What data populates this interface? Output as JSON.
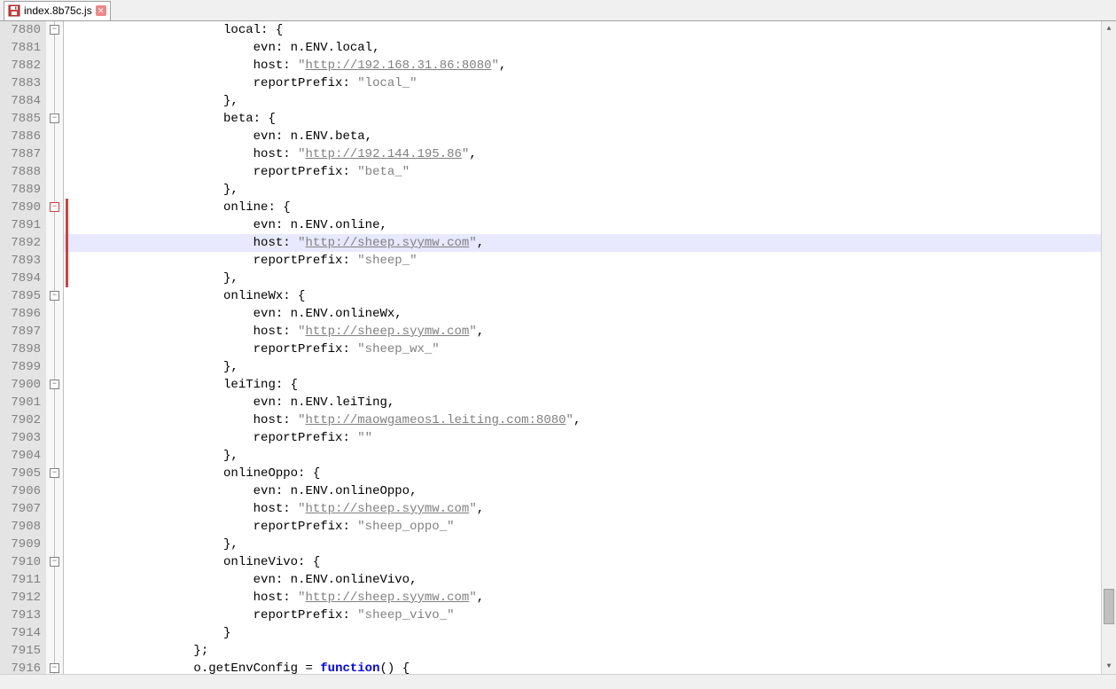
{
  "tab": {
    "filename": "index.8b75c.js",
    "unsaved": true
  },
  "lineStart": 7880,
  "highlightedLine": 7892,
  "foldBoxes": [
    {
      "line": 7880,
      "type": "minus"
    },
    {
      "line": 7885,
      "type": "minus"
    },
    {
      "line": 7890,
      "type": "minus-red"
    },
    {
      "line": 7895,
      "type": "minus"
    },
    {
      "line": 7900,
      "type": "minus"
    },
    {
      "line": 7905,
      "type": "minus"
    },
    {
      "line": 7910,
      "type": "minus"
    },
    {
      "line": 7916,
      "type": "minus"
    }
  ],
  "marginBar": {
    "startLine": 7890,
    "endLine": 7894
  },
  "lines": [
    {
      "n": 7880,
      "indent": 20,
      "tokens": [
        {
          "t": "ident",
          "v": "local"
        },
        {
          "t": "op",
          "v": ": {"
        }
      ]
    },
    {
      "n": 7881,
      "indent": 24,
      "tokens": [
        {
          "t": "ident",
          "v": "evn"
        },
        {
          "t": "op",
          "v": ": n.ENV.local,"
        }
      ]
    },
    {
      "n": 7882,
      "indent": 24,
      "tokens": [
        {
          "t": "ident",
          "v": "host"
        },
        {
          "t": "op",
          "v": ": "
        },
        {
          "t": "str",
          "v": "\""
        },
        {
          "t": "url",
          "v": "http://192.168.31.86:8080"
        },
        {
          "t": "str",
          "v": "\""
        },
        {
          "t": "op",
          "v": ","
        }
      ]
    },
    {
      "n": 7883,
      "indent": 24,
      "tokens": [
        {
          "t": "ident",
          "v": "reportPrefix"
        },
        {
          "t": "op",
          "v": ": "
        },
        {
          "t": "str",
          "v": "\"local_\""
        }
      ]
    },
    {
      "n": 7884,
      "indent": 20,
      "tokens": [
        {
          "t": "op",
          "v": "},"
        }
      ]
    },
    {
      "n": 7885,
      "indent": 20,
      "tokens": [
        {
          "t": "ident",
          "v": "beta"
        },
        {
          "t": "op",
          "v": ": {"
        }
      ]
    },
    {
      "n": 7886,
      "indent": 24,
      "tokens": [
        {
          "t": "ident",
          "v": "evn"
        },
        {
          "t": "op",
          "v": ": n.ENV.beta,"
        }
      ]
    },
    {
      "n": 7887,
      "indent": 24,
      "tokens": [
        {
          "t": "ident",
          "v": "host"
        },
        {
          "t": "op",
          "v": ": "
        },
        {
          "t": "str",
          "v": "\""
        },
        {
          "t": "url",
          "v": "http://192.144.195.86"
        },
        {
          "t": "str",
          "v": "\""
        },
        {
          "t": "op",
          "v": ","
        }
      ]
    },
    {
      "n": 7888,
      "indent": 24,
      "tokens": [
        {
          "t": "ident",
          "v": "reportPrefix"
        },
        {
          "t": "op",
          "v": ": "
        },
        {
          "t": "str",
          "v": "\"beta_\""
        }
      ]
    },
    {
      "n": 7889,
      "indent": 20,
      "tokens": [
        {
          "t": "op",
          "v": "},"
        }
      ]
    },
    {
      "n": 7890,
      "indent": 20,
      "tokens": [
        {
          "t": "ident",
          "v": "online"
        },
        {
          "t": "op",
          "v": ": {"
        }
      ]
    },
    {
      "n": 7891,
      "indent": 24,
      "tokens": [
        {
          "t": "ident",
          "v": "evn"
        },
        {
          "t": "op",
          "v": ": n.ENV.online,"
        }
      ]
    },
    {
      "n": 7892,
      "indent": 24,
      "tokens": [
        {
          "t": "ident",
          "v": "host"
        },
        {
          "t": "op",
          "v": ": "
        },
        {
          "t": "str",
          "v": "\""
        },
        {
          "t": "url",
          "v": "http://sheep.syymw.com"
        },
        {
          "t": "str",
          "v": "\""
        },
        {
          "t": "op",
          "v": ","
        }
      ]
    },
    {
      "n": 7893,
      "indent": 24,
      "tokens": [
        {
          "t": "ident",
          "v": "reportPrefix"
        },
        {
          "t": "op",
          "v": ": "
        },
        {
          "t": "str",
          "v": "\"sheep_\""
        }
      ]
    },
    {
      "n": 7894,
      "indent": 20,
      "tokens": [
        {
          "t": "op",
          "v": "},"
        }
      ]
    },
    {
      "n": 7895,
      "indent": 20,
      "tokens": [
        {
          "t": "ident",
          "v": "onlineWx"
        },
        {
          "t": "op",
          "v": ": {"
        }
      ]
    },
    {
      "n": 7896,
      "indent": 24,
      "tokens": [
        {
          "t": "ident",
          "v": "evn"
        },
        {
          "t": "op",
          "v": ": n.ENV.onlineWx,"
        }
      ]
    },
    {
      "n": 7897,
      "indent": 24,
      "tokens": [
        {
          "t": "ident",
          "v": "host"
        },
        {
          "t": "op",
          "v": ": "
        },
        {
          "t": "str",
          "v": "\""
        },
        {
          "t": "url",
          "v": "http://sheep.syymw.com"
        },
        {
          "t": "str",
          "v": "\""
        },
        {
          "t": "op",
          "v": ","
        }
      ]
    },
    {
      "n": 7898,
      "indent": 24,
      "tokens": [
        {
          "t": "ident",
          "v": "reportPrefix"
        },
        {
          "t": "op",
          "v": ": "
        },
        {
          "t": "str",
          "v": "\"sheep_wx_\""
        }
      ]
    },
    {
      "n": 7899,
      "indent": 20,
      "tokens": [
        {
          "t": "op",
          "v": "},"
        }
      ]
    },
    {
      "n": 7900,
      "indent": 20,
      "tokens": [
        {
          "t": "ident",
          "v": "leiTing"
        },
        {
          "t": "op",
          "v": ": {"
        }
      ]
    },
    {
      "n": 7901,
      "indent": 24,
      "tokens": [
        {
          "t": "ident",
          "v": "evn"
        },
        {
          "t": "op",
          "v": ": n.ENV.leiTing,"
        }
      ]
    },
    {
      "n": 7902,
      "indent": 24,
      "tokens": [
        {
          "t": "ident",
          "v": "host"
        },
        {
          "t": "op",
          "v": ": "
        },
        {
          "t": "str",
          "v": "\""
        },
        {
          "t": "url",
          "v": "http://maowgameos1.leiting.com:8080"
        },
        {
          "t": "str",
          "v": "\""
        },
        {
          "t": "op",
          "v": ","
        }
      ]
    },
    {
      "n": 7903,
      "indent": 24,
      "tokens": [
        {
          "t": "ident",
          "v": "reportPrefix"
        },
        {
          "t": "op",
          "v": ": "
        },
        {
          "t": "str",
          "v": "\"\""
        }
      ]
    },
    {
      "n": 7904,
      "indent": 20,
      "tokens": [
        {
          "t": "op",
          "v": "},"
        }
      ]
    },
    {
      "n": 7905,
      "indent": 20,
      "tokens": [
        {
          "t": "ident",
          "v": "onlineOppo"
        },
        {
          "t": "op",
          "v": ": {"
        }
      ]
    },
    {
      "n": 7906,
      "indent": 24,
      "tokens": [
        {
          "t": "ident",
          "v": "evn"
        },
        {
          "t": "op",
          "v": ": n.ENV.onlineOppo,"
        }
      ]
    },
    {
      "n": 7907,
      "indent": 24,
      "tokens": [
        {
          "t": "ident",
          "v": "host"
        },
        {
          "t": "op",
          "v": ": "
        },
        {
          "t": "str",
          "v": "\""
        },
        {
          "t": "url",
          "v": "http://sheep.syymw.com"
        },
        {
          "t": "str",
          "v": "\""
        },
        {
          "t": "op",
          "v": ","
        }
      ]
    },
    {
      "n": 7908,
      "indent": 24,
      "tokens": [
        {
          "t": "ident",
          "v": "reportPrefix"
        },
        {
          "t": "op",
          "v": ": "
        },
        {
          "t": "str",
          "v": "\"sheep_oppo_\""
        }
      ]
    },
    {
      "n": 7909,
      "indent": 20,
      "tokens": [
        {
          "t": "op",
          "v": "},"
        }
      ]
    },
    {
      "n": 7910,
      "indent": 20,
      "tokens": [
        {
          "t": "ident",
          "v": "onlineVivo"
        },
        {
          "t": "op",
          "v": ": {"
        }
      ]
    },
    {
      "n": 7911,
      "indent": 24,
      "tokens": [
        {
          "t": "ident",
          "v": "evn"
        },
        {
          "t": "op",
          "v": ": n.ENV.onlineVivo,"
        }
      ]
    },
    {
      "n": 7912,
      "indent": 24,
      "tokens": [
        {
          "t": "ident",
          "v": "host"
        },
        {
          "t": "op",
          "v": ": "
        },
        {
          "t": "str",
          "v": "\""
        },
        {
          "t": "url",
          "v": "http://sheep.syymw.com"
        },
        {
          "t": "str",
          "v": "\""
        },
        {
          "t": "op",
          "v": ","
        }
      ]
    },
    {
      "n": 7913,
      "indent": 24,
      "tokens": [
        {
          "t": "ident",
          "v": "reportPrefix"
        },
        {
          "t": "op",
          "v": ": "
        },
        {
          "t": "str",
          "v": "\"sheep_vivo_\""
        }
      ]
    },
    {
      "n": 7914,
      "indent": 20,
      "tokens": [
        {
          "t": "op",
          "v": "}"
        }
      ]
    },
    {
      "n": 7915,
      "indent": 16,
      "tokens": [
        {
          "t": "op",
          "v": "};"
        }
      ]
    },
    {
      "n": 7916,
      "indent": 16,
      "tokens": [
        {
          "t": "ident",
          "v": "o.getEnvConfig "
        },
        {
          "t": "op",
          "v": "= "
        },
        {
          "t": "kw",
          "v": "function"
        },
        {
          "t": "op",
          "v": "() {"
        }
      ]
    }
  ],
  "scroll": {
    "thumbTop": 640,
    "thumbHeight": 40
  }
}
